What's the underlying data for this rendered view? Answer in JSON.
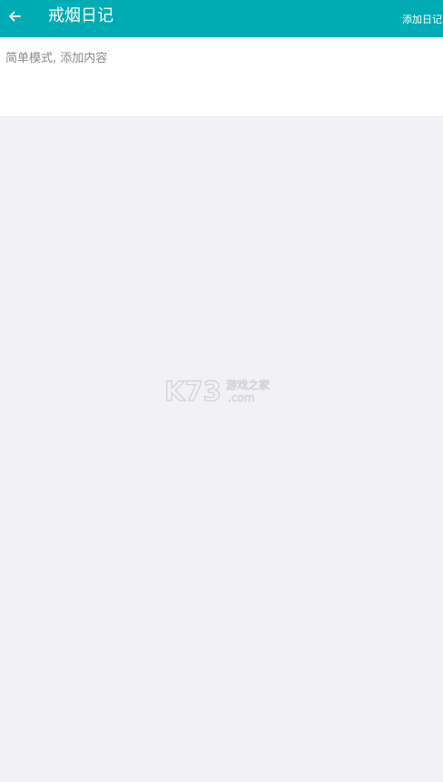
{
  "header": {
    "title": "戒烟日记",
    "action_label": "添加日记",
    "back_icon": "arrow-left-icon",
    "background": "#00acb3"
  },
  "editor": {
    "value": "",
    "placeholder": "简单模式, 添加内容"
  },
  "watermark": {
    "brand": "K73",
    "tagline": "游戏之家",
    "domain": ".com"
  },
  "colors": {
    "accent": "#00acb3",
    "page_background": "#f1f1f6",
    "panel_background": "#ffffff"
  }
}
